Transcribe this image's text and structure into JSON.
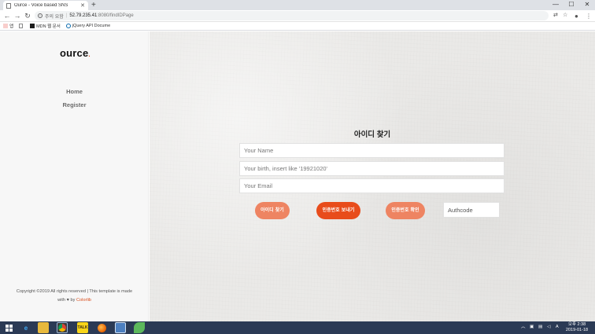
{
  "browser": {
    "tab_title": "Ource - Voice based SNS",
    "new_tab": "+",
    "url_security": "주의 요함",
    "url_host": "52.79.235.41",
    "url_path": ":8080/findIDPage",
    "minimize": "—",
    "maximize": "☐",
    "close": "✕",
    "bookmarks": [
      {
        "label": "앱"
      },
      {
        "label": ""
      },
      {
        "label": "MDN 웹 문서"
      },
      {
        "label": "jQuery API Docume"
      }
    ]
  },
  "sidebar": {
    "logo": "ource",
    "logo_dot": ".",
    "nav": [
      {
        "label": "Home"
      },
      {
        "label": "Register"
      }
    ],
    "copyright_line1": "Copyright ©2019 All rights reserved | This template is made",
    "copyright_with": "with",
    "copyright_by": "by",
    "copyright_link": "Colorlib"
  },
  "form": {
    "title": "아이디 찾기",
    "name_placeholder": "Your Name",
    "birth_placeholder": "Your birth, insert like '19921020'",
    "email_placeholder": "Your Email",
    "find_id_button": "아이디 찾기",
    "send_code_button": "인증번호 보내기",
    "verify_code_button": "인증번호 확인",
    "authcode_placeholder": "Authcode"
  },
  "colors": {
    "accent": "#e84c1b",
    "accent_light": "#ee8462",
    "taskbar": "#2b3a55"
  },
  "taskbar": {
    "clock_time": "오후 2:38",
    "clock_date": "2019-01-18"
  }
}
